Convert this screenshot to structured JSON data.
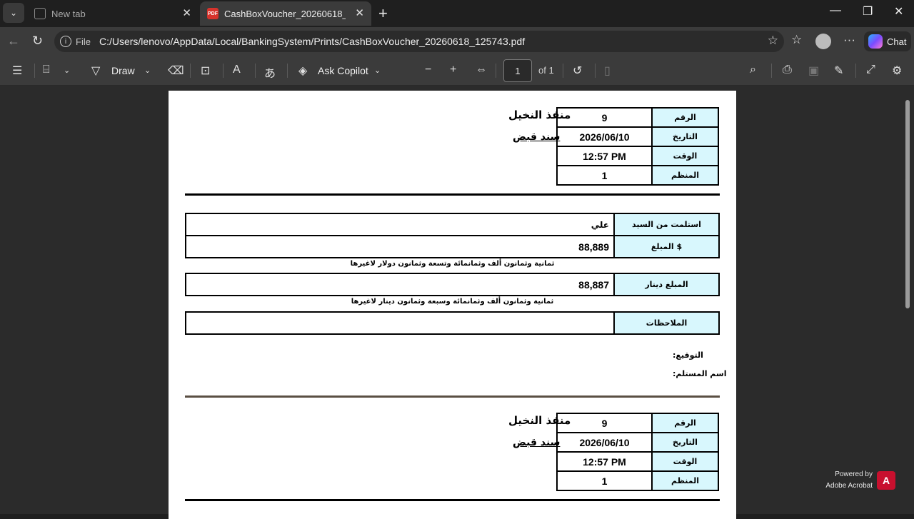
{
  "browser": {
    "tabs": [
      {
        "title": "New tab",
        "active": false
      },
      {
        "title": "CashBoxVoucher_20260618_125743.pdf",
        "active": true
      }
    ],
    "address": {
      "scheme_label": "File",
      "url": "C:/Users/lenovo/AppData/Local/BankingSystem/Prints/CashBoxVoucher_20260618_125743.pdf"
    },
    "copilot_label": "Chat"
  },
  "pdf_toolbar": {
    "draw_label": "Draw",
    "ask_copilot_label": "Ask Copilot",
    "page_current": "1",
    "page_total_label": "of 1"
  },
  "voucher": {
    "branch_name": "منفذ النخيل",
    "voucher_type": "سند قبض",
    "header_rows": [
      {
        "label": "الرقم",
        "value": "9"
      },
      {
        "label": "التاريخ",
        "value": "2026/06/10"
      },
      {
        "label": "الوقت",
        "value": "12:57 PM"
      },
      {
        "label": "المنظم",
        "value": "1"
      }
    ],
    "received_from_label": "استلمت من السيد",
    "received_from_value": "علي",
    "amount_usd_label": "$ المبلغ",
    "amount_usd_value": "88,889",
    "amount_usd_words": "ثمانية وثمانون ألف وثمانمائة وتسعة وثمانون دولار لاغيرها",
    "amount_iqd_label": "المبلغ دينار",
    "amount_iqd_value": "88,887",
    "amount_iqd_words": "ثمانية وثمانون ألف وثمانمائة وسبعة وثمانون دينار لاغيرها",
    "notes_label": "الملاحظات",
    "notes_value": "",
    "signature_label": "التوقيع:",
    "receiver_name_label": "اسم المستلم:"
  },
  "footer": {
    "powered_by": "Powered by",
    "product": "Adobe Acrobat"
  }
}
